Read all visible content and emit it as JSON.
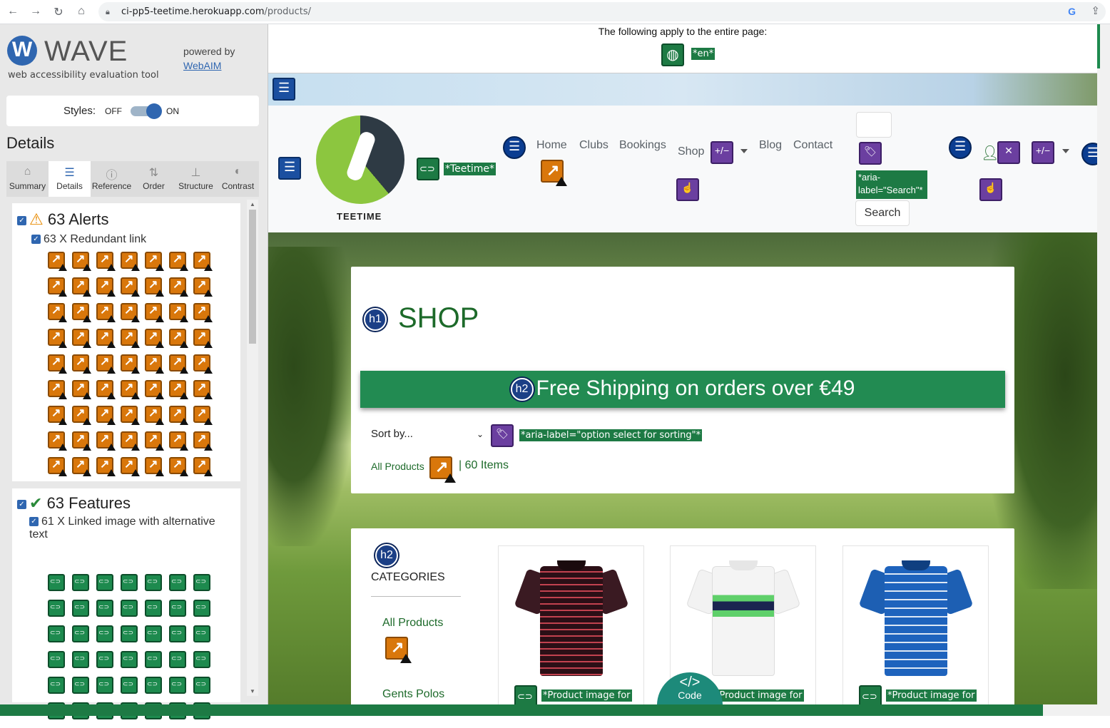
{
  "browser": {
    "url_host": "ci-pp5-teetime.herokuapp.com",
    "url_path": "/products/"
  },
  "wave": {
    "title": "WAVE",
    "subtitle": "web accessibility evaluation tool",
    "powered_by": "powered by",
    "webaim": "WebAIM",
    "styles_label": "Styles:",
    "styles_off": "OFF",
    "styles_on": "ON",
    "details_heading": "Details",
    "tabs": [
      {
        "label": "Summary",
        "icon": "home-icon"
      },
      {
        "label": "Details",
        "icon": "list-icon",
        "active": true
      },
      {
        "label": "Reference",
        "icon": "info-icon"
      },
      {
        "label": "Order",
        "icon": "order-icon"
      },
      {
        "label": "Structure",
        "icon": "structure-icon"
      },
      {
        "label": "Contrast",
        "icon": "contrast-icon"
      }
    ],
    "alerts": {
      "title": "63 Alerts",
      "item": "63 X Redundant link",
      "icon_count": 63
    },
    "features": {
      "title": "63 Features",
      "item": "61 X Linked image with alternative text",
      "visible_icon_count": 42
    }
  },
  "page": {
    "note": "The following apply to the entire page:",
    "lang_tag": "*en*",
    "logo_text": "TEETIME",
    "logo_alt_tag": "*Teetime*",
    "nav": [
      "Home",
      "Clubs",
      "Bookings",
      "Shop",
      "Blog",
      "Contact"
    ],
    "search_aria": "*aria-label=\"Search\"*",
    "search_button": "Search",
    "heading_h1": "SHOP",
    "h1_badge": "h1",
    "h2_badge": "h2",
    "shipping": "Free Shipping on orders over €49",
    "sort_label": "Sort by...",
    "sort_aria": "*aria-label=\"option select for sorting\"*",
    "all_products": "All Products",
    "items_count": "| 60 Items",
    "categories_heading": "CATEGORIES",
    "categories": [
      "All Products",
      "Gents Polos"
    ],
    "product_alt": "*Product image for",
    "code_button": "Code"
  },
  "colors": {
    "wave_blue": "#2f66b0",
    "brand_green": "#1d6a2a",
    "banner_green": "#228B52",
    "alert_orange": "#d9770b",
    "feature_green": "#1d8a4e"
  }
}
